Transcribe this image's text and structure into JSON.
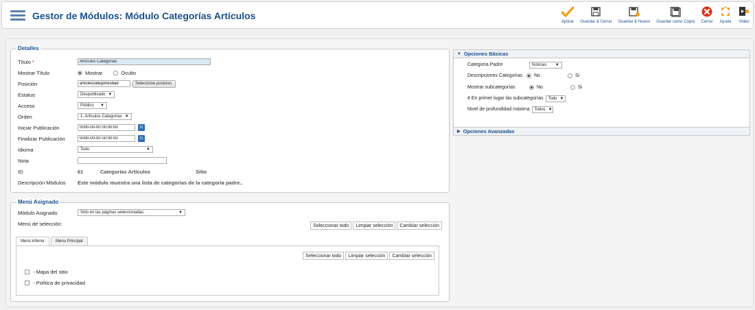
{
  "header": {
    "title": "Gestor de Módulos: Módulo Categorías Artículos",
    "toolbar": [
      {
        "label": "Aplicar",
        "icon": "checkmark-icon"
      },
      {
        "label": "Guardar & Cerrar",
        "icon": "save-icon"
      },
      {
        "label": "Guardar & Nuevo",
        "icon": "save-new-icon"
      },
      {
        "label": "Guardar como Copia",
        "icon": "save-copy-icon"
      },
      {
        "label": "Cerrar",
        "icon": "cancel-icon"
      },
      {
        "label": "Ayuda",
        "icon": "help-icon"
      },
      {
        "label": "Video",
        "icon": "video-icon"
      }
    ]
  },
  "details": {
    "legend": "Detalles",
    "titulo_label": "Título",
    "required_mark": "*",
    "titulo_value": "Artículos Categorías",
    "mostrar_titulo_label": "Mostrar Título",
    "mostrar_option": "Mostrar",
    "oculto_option": "Oculto",
    "posicion_label": "Posición",
    "posicion_value": "articlescategoriesbad",
    "seleccione_posicion": "Seleccione posicion.",
    "estatus_label": "Estatus",
    "estatus_value": "Despublicado",
    "acceso_label": "Acceso",
    "acceso_value": "Público",
    "orden_label": "Orden",
    "orden_value": "1. Artículos Categorías",
    "iniciar_label": "Iniciar Publicación",
    "iniciar_value": "0000-00-00 00:00:00",
    "finalizar_label": "Finalizar Publicación",
    "finalizar_value": "0000-00-00 00:00:00",
    "idioma_label": "Idioma",
    "idioma_value": "Todo",
    "nota_label": "Nota",
    "nota_value": "",
    "id_label": "ID",
    "id_value": "61",
    "id_type": "Categorías Artículos",
    "id_site": "Sitio",
    "descripcion_label": "Descripción Módulos",
    "descripcion_value": "Este módulo muestra una lista de categorías de la categoría padre..",
    "calendar_icon_text": "31"
  },
  "menu": {
    "legend": "Menú Asignado",
    "modulo_asignado_label": "Módulo Asignado",
    "modulo_asignado_value": "Sólo en las páginas seleccionadas.",
    "menu_seleccion_label": "Menú de selección:",
    "btn_select_all": "Seleccionar todo",
    "btn_clear": "Limpiar selección",
    "btn_toggle": "Cambiar selección",
    "tabs": [
      "Menú inferior",
      "Menu Principal"
    ],
    "items": [
      "- Mapa del sitio",
      "- Política de privacidad"
    ]
  },
  "basic": {
    "heading": "Opciones Básicas",
    "categoria_padre_label": "Categoría Padre",
    "categoria_padre_value": "Noticias",
    "descripciones_label": "Descripciones Categorías",
    "mostrar_sub_label": "Mostrar subcategorías",
    "no": "No",
    "si": "Si",
    "primer_lugar_label": "# En primer lugar las subcategorías",
    "primer_lugar_value": "Todo",
    "nivel_label": "Nivel de profundidad máxima",
    "nivel_value": "Todos"
  },
  "advanced": {
    "heading": "Opciones Avanzadas"
  },
  "colors": {
    "accent": "#1a4f8a",
    "apply": "#f0a020",
    "close": "#d9341e"
  }
}
